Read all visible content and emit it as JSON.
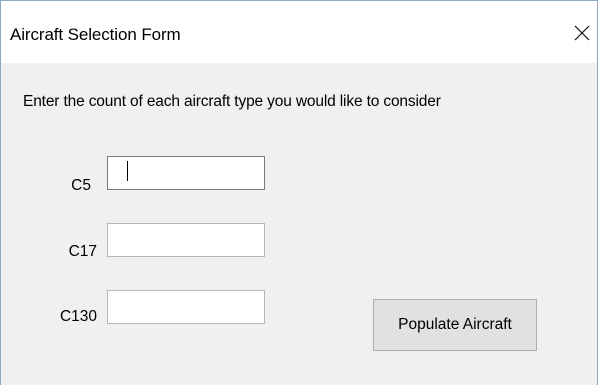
{
  "window": {
    "title": "Aircraft Selection Form"
  },
  "form": {
    "instruction": "Enter the count of each aircraft type you would like to consider",
    "fields": [
      {
        "label": "C5",
        "value": ""
      },
      {
        "label": "C17",
        "value": ""
      },
      {
        "label": "C130",
        "value": ""
      }
    ],
    "populate_button": "Populate Aircraft"
  },
  "icons": {
    "close": "close-icon"
  },
  "colors": {
    "window_border": "#8aaac8",
    "client_background": "#f0f0f0",
    "button_background": "#e1e1e1"
  }
}
